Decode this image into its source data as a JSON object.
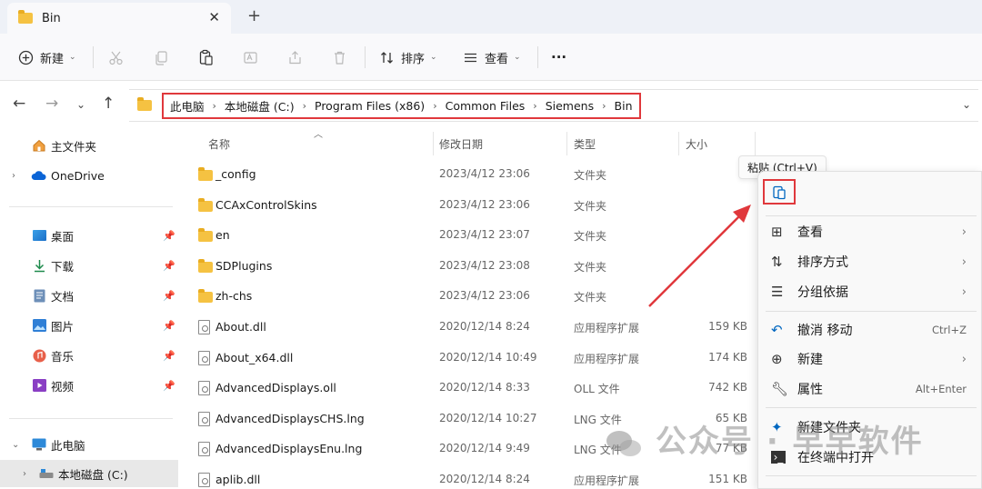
{
  "window": {
    "tab_title": "Bin",
    "close_glyph": "✕",
    "new_tab_glyph": "+"
  },
  "toolbar": {
    "new_label": "新建",
    "sort_label": "排序",
    "view_label": "查看",
    "more_glyph": "···",
    "icons": [
      "plus-circle-icon",
      "cut-icon",
      "copy-icon",
      "paste-icon",
      "rename-icon",
      "share-icon",
      "delete-icon",
      "sort-icon",
      "view-icon",
      "more-icon"
    ]
  },
  "address": {
    "crumbs": [
      "此电脑",
      "本地磁盘 (C:)",
      "Program Files (x86)",
      "Common Files",
      "Siemens",
      "Bin"
    ]
  },
  "sidebar": {
    "home": "主文件夹",
    "onedrive": "OneDrive",
    "quick": [
      {
        "label": "桌面",
        "icon": "desktop-icon"
      },
      {
        "label": "下载",
        "icon": "download-icon"
      },
      {
        "label": "文档",
        "icon": "document-icon"
      },
      {
        "label": "图片",
        "icon": "picture-icon"
      },
      {
        "label": "音乐",
        "icon": "music-icon"
      },
      {
        "label": "视频",
        "icon": "video-icon"
      }
    ],
    "thispc": "此电脑",
    "drive": "本地磁盘 (C:)"
  },
  "columns": {
    "name": "名称",
    "date": "修改日期",
    "type": "类型",
    "size": "大小"
  },
  "files": [
    {
      "name": "_config",
      "date": "2023/4/12 23:06",
      "type": "文件夹",
      "size": "",
      "kind": "folder"
    },
    {
      "name": "CCAxControlSkins",
      "date": "2023/4/12 23:06",
      "type": "文件夹",
      "size": "",
      "kind": "folder"
    },
    {
      "name": "en",
      "date": "2023/4/12 23:07",
      "type": "文件夹",
      "size": "",
      "kind": "folder"
    },
    {
      "name": "SDPlugins",
      "date": "2023/4/12 23:08",
      "type": "文件夹",
      "size": "",
      "kind": "folder"
    },
    {
      "name": "zh-chs",
      "date": "2023/4/12 23:06",
      "type": "文件夹",
      "size": "",
      "kind": "folder"
    },
    {
      "name": "About.dll",
      "date": "2020/12/14 8:24",
      "type": "应用程序扩展",
      "size": "159 KB",
      "kind": "file"
    },
    {
      "name": "About_x64.dll",
      "date": "2020/12/14 10:49",
      "type": "应用程序扩展",
      "size": "174 KB",
      "kind": "file"
    },
    {
      "name": "AdvancedDisplays.oll",
      "date": "2020/12/14 8:33",
      "type": "OLL 文件",
      "size": "742 KB",
      "kind": "file"
    },
    {
      "name": "AdvancedDisplaysCHS.lng",
      "date": "2020/12/14 10:27",
      "type": "LNG 文件",
      "size": "65 KB",
      "kind": "file"
    },
    {
      "name": "AdvancedDisplaysEnu.lng",
      "date": "2020/12/14 9:49",
      "type": "LNG 文件",
      "size": "77 KB",
      "kind": "file"
    },
    {
      "name": "aplib.dll",
      "date": "2020/12/14 8:24",
      "type": "应用程序扩展",
      "size": "151 KB",
      "kind": "file"
    }
  ],
  "context_menu": {
    "tooltip": "粘贴 (Ctrl+V)",
    "view": "查看",
    "sort_by": "排序方式",
    "group_by": "分组依据",
    "undo": "撤消 移动",
    "undo_shortcut": "Ctrl+Z",
    "new": "新建",
    "properties": "属性",
    "properties_shortcut": "Alt+Enter",
    "new_folder": "新建文件夹",
    "open_terminal": "在终端中打开"
  },
  "watermark": "公众号 · 早早软件",
  "colors": {
    "highlight_red": "#e0383c",
    "folder_yellow": "#f5c242",
    "accent_blue": "#0067c0"
  }
}
